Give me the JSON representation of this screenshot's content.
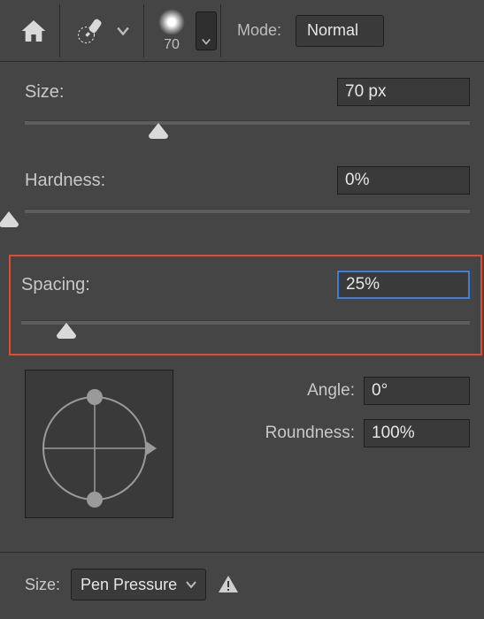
{
  "toolbar": {
    "brush_size_preview": "70",
    "mode_label": "Mode:",
    "mode_value": "Normal"
  },
  "brush": {
    "size_label": "Size:",
    "size_value": "70 px",
    "size_percent": 30,
    "hardness_label": "Hardness:",
    "hardness_value": "0%",
    "hardness_percent": 0,
    "spacing_label": "Spacing:",
    "spacing_value": "25%",
    "spacing_percent": 10,
    "angle_label": "Angle:",
    "angle_value": "0°",
    "roundness_label": "Roundness:",
    "roundness_value": "100%"
  },
  "bottom": {
    "size_label": "Size:",
    "size_control": "Pen Pressure"
  }
}
